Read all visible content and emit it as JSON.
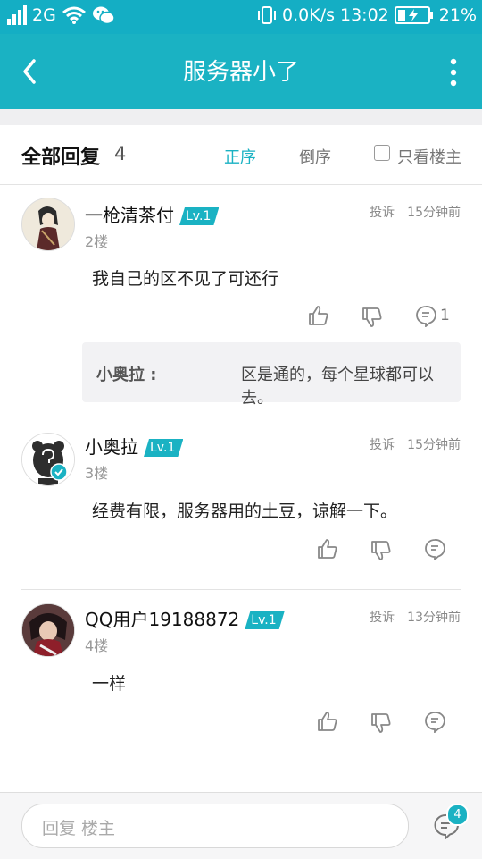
{
  "status_bar": {
    "network": "2G",
    "speed": "0.0K/s",
    "time": "13:02",
    "battery": "21%"
  },
  "header": {
    "title": "服务器小了"
  },
  "reply_header": {
    "title": "全部回复",
    "count": "4",
    "sort_asc": "正序",
    "sort_desc": "倒序",
    "only_host": "只看楼主"
  },
  "posts": [
    {
      "username": "一枪清茶付",
      "level": "Lv.1",
      "report": "投诉",
      "time": "15分钟前",
      "floor": "2楼",
      "content": "我自己的区不见了可还行",
      "comment_count": "1",
      "quote": {
        "name": "小奥拉 :",
        "text": "区是通的，每个星球都可以去。"
      }
    },
    {
      "username": "小奥拉",
      "level": "Lv.1",
      "report": "投诉",
      "time": "15分钟前",
      "floor": "3楼",
      "content": "经费有限，服务器用的土豆，谅解一下。"
    },
    {
      "username": "QQ用户19188872",
      "level": "Lv.1",
      "report": "投诉",
      "time": "13分钟前",
      "floor": "4楼",
      "content": "一样"
    }
  ],
  "bottom": {
    "reply_placeholder": "回复  楼主",
    "badge_count": "4"
  },
  "colors": {
    "accent": "#1ab2c3",
    "status_bar": "#14aec4"
  }
}
